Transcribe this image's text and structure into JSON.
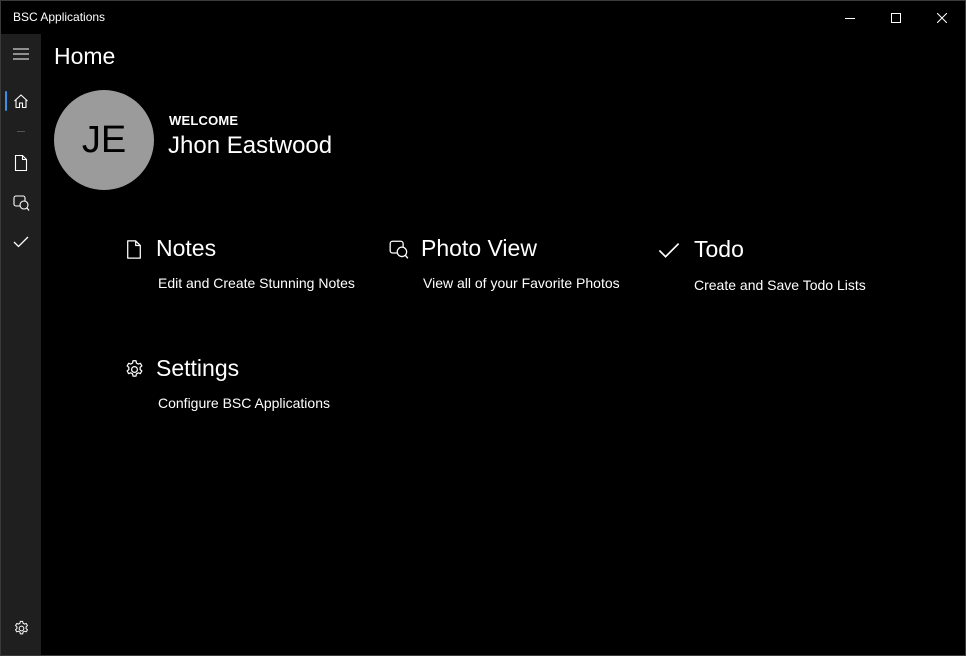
{
  "window": {
    "title": "BSC Applications",
    "controls": {
      "minimize": "minimize-icon",
      "maximize": "maximize-icon",
      "close": "close-icon"
    }
  },
  "nav": {
    "items": [
      {
        "name": "hamburger-menu",
        "icon": "hamburger-icon"
      },
      {
        "name": "home",
        "icon": "home-icon",
        "selected": true
      },
      {
        "name": "notes",
        "icon": "document-icon"
      },
      {
        "name": "photo-view",
        "icon": "photo-icon"
      },
      {
        "name": "todo",
        "icon": "checkmark-icon"
      },
      {
        "name": "settings",
        "icon": "gear-icon"
      }
    ],
    "accent_color": "#3b8eea"
  },
  "page": {
    "title": "Home",
    "avatar_initials": "JE",
    "welcome_label": "WELCOME",
    "user_name": "Jhon Eastwood"
  },
  "tiles": {
    "notes": {
      "title": "Notes",
      "description": "Edit and Create Stunning Notes",
      "icon": "document-icon"
    },
    "photo": {
      "title": "Photo View",
      "description": "View all of your Favorite Photos",
      "icon": "photo-icon"
    },
    "todo": {
      "title": "Todo",
      "description": "Create and Save Todo Lists",
      "icon": "checkmark-icon"
    },
    "settings": {
      "title": "Settings",
      "description": "Configure BSC Applications",
      "icon": "gear-icon"
    }
  }
}
